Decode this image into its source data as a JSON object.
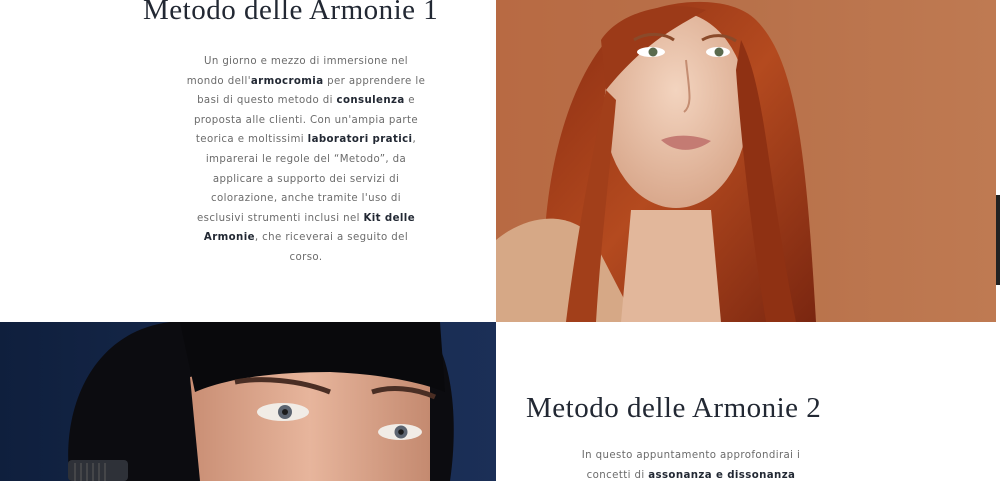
{
  "courses": [
    {
      "title": "Metodo delle Armonie 1",
      "description": [
        {
          "t": "Un giorno e mezzo di immersione nel mondo dell'",
          "b": false
        },
        {
          "t": "armocromia",
          "b": true
        },
        {
          "t": " per apprendere le basi di questo metodo di ",
          "b": false
        },
        {
          "t": "consulenza",
          "b": true
        },
        {
          "t": " e proposta alle clienti. Con un'ampia parte teorica e moltissimi ",
          "b": false
        },
        {
          "t": "laboratori pratici",
          "b": true
        },
        {
          "t": ", imparerai le regole del “Metodo”, da applicare a supporto dei servizi di colorazione, anche tramite l'uso di esclusivi strumenti inclusi nel ",
          "b": false
        },
        {
          "t": "Kit delle Armonie",
          "b": true
        },
        {
          "t": ", che riceverai a seguito del corso.",
          "b": false
        }
      ],
      "image_alt": "Ritratto donna capelli rossi"
    },
    {
      "title": "Metodo delle Armonie 2",
      "description": [
        {
          "t": "In questo appuntamento approfondirai i concetti di ",
          "b": false
        },
        {
          "t": "assonanza e dissonanza",
          "b": true
        }
      ],
      "image_alt": "Ritratto donna capelli neri con frangia"
    }
  ],
  "colors": {
    "title": "#222833",
    "body_text": "#6b6b6b",
    "photo1_bg": "#b8714a",
    "photo2_bg": "#16284a"
  }
}
